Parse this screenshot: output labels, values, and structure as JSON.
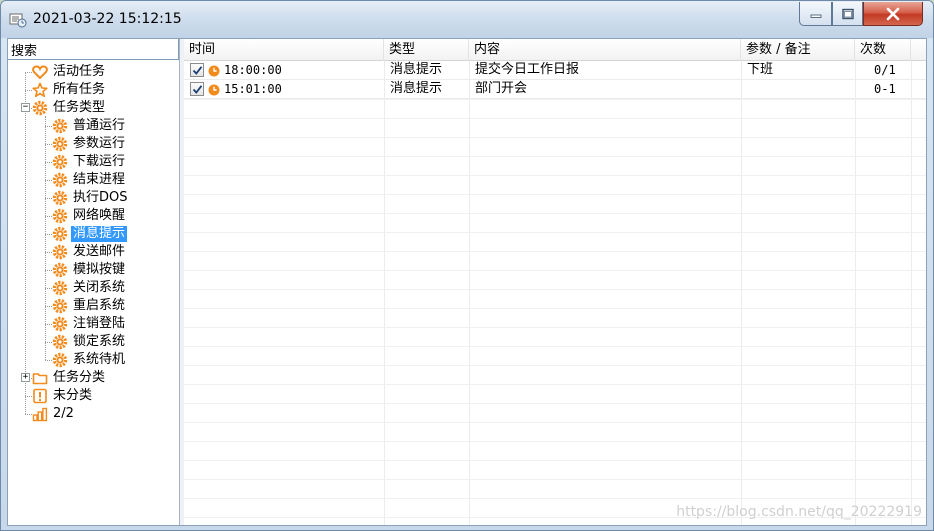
{
  "window": {
    "title": "2021-03-22 15:12:15",
    "colors": {
      "close": "#c23a23",
      "selection": "#3399ff",
      "task_icon": "#f28a1c"
    }
  },
  "sidebar": {
    "search_label": "搜索",
    "tree": [
      {
        "label": "活动任务",
        "icon": "heart-icon"
      },
      {
        "label": "所有任务",
        "icon": "star-icon"
      },
      {
        "label": "任务类型",
        "icon": "gear-icon",
        "expanded": true,
        "expander": "−"
      },
      {
        "label": "普通运行",
        "icon": "gear-icon"
      },
      {
        "label": "参数运行",
        "icon": "gear-icon"
      },
      {
        "label": "下载运行",
        "icon": "gear-icon"
      },
      {
        "label": "结束进程",
        "icon": "gear-icon"
      },
      {
        "label": "执行DOS",
        "icon": "gear-icon"
      },
      {
        "label": "网络唤醒",
        "icon": "gear-icon"
      },
      {
        "label": "消息提示",
        "icon": "gear-icon",
        "selected": true
      },
      {
        "label": "发送邮件",
        "icon": "gear-icon"
      },
      {
        "label": "模拟按键",
        "icon": "gear-icon"
      },
      {
        "label": "关闭系统",
        "icon": "gear-icon"
      },
      {
        "label": "重启系统",
        "icon": "gear-icon"
      },
      {
        "label": "注销登陆",
        "icon": "gear-icon"
      },
      {
        "label": "锁定系统",
        "icon": "gear-icon"
      },
      {
        "label": "系统待机",
        "icon": "gear-icon"
      },
      {
        "label": "任务分类",
        "icon": "folder-icon",
        "expander": "+"
      },
      {
        "label": "未分类",
        "icon": "exclamation-icon"
      },
      {
        "label": "2/2",
        "icon": "bar-chart-icon"
      }
    ]
  },
  "table": {
    "columns": [
      "时间",
      "类型",
      "内容",
      "参数 / 备注",
      "次数"
    ],
    "rows": [
      {
        "checked": true,
        "time": "18:00:00",
        "type": "消息提示",
        "content": "提交今日工作日报",
        "param": "下班",
        "count": "0/1"
      },
      {
        "checked": true,
        "time": "15:01:00",
        "type": "消息提示",
        "content": "部门开会",
        "param": "",
        "count": "0-1"
      }
    ]
  },
  "watermark": "https://blog.csdn.net/qq_20222919"
}
